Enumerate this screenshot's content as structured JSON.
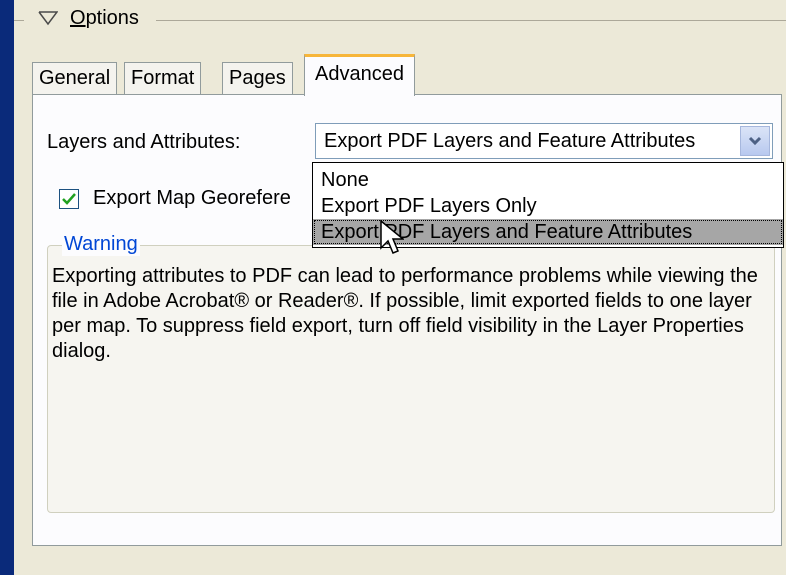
{
  "options_group": {
    "label_prefix": "",
    "mnemonic": "O",
    "label_rest": "ptions",
    "toggle_icon": "chevron-down-outline-icon"
  },
  "tabs": [
    {
      "label": "General",
      "active": false
    },
    {
      "label": "Format",
      "active": false
    },
    {
      "label": "Pages",
      "active": false
    },
    {
      "label": "Advanced",
      "active": true
    }
  ],
  "layers": {
    "label": "Layers and Attributes:",
    "selected_value": "Export PDF Layers and Feature Attributes",
    "options": [
      "None",
      "Export PDF Layers Only",
      "Export PDF Layers and Feature Attributes"
    ],
    "highlighted_index": 2
  },
  "georef": {
    "label": "Export Map Georefere",
    "checked": true
  },
  "warning": {
    "title": "Warning",
    "text": "Exporting attributes to PDF can lead to performance problems while viewing the file in Adobe Acrobat® or Reader®.  If possible, limit exported fields to one layer per map. To suppress field export, turn off field visibility in the Layer Properties dialog."
  },
  "colors": {
    "background": "#0a2a7a",
    "panel": "#ece9d8",
    "active_tab_accent": "#f7b63a",
    "warning_title": "#0046d5",
    "highlight": "#a6a6a6"
  }
}
